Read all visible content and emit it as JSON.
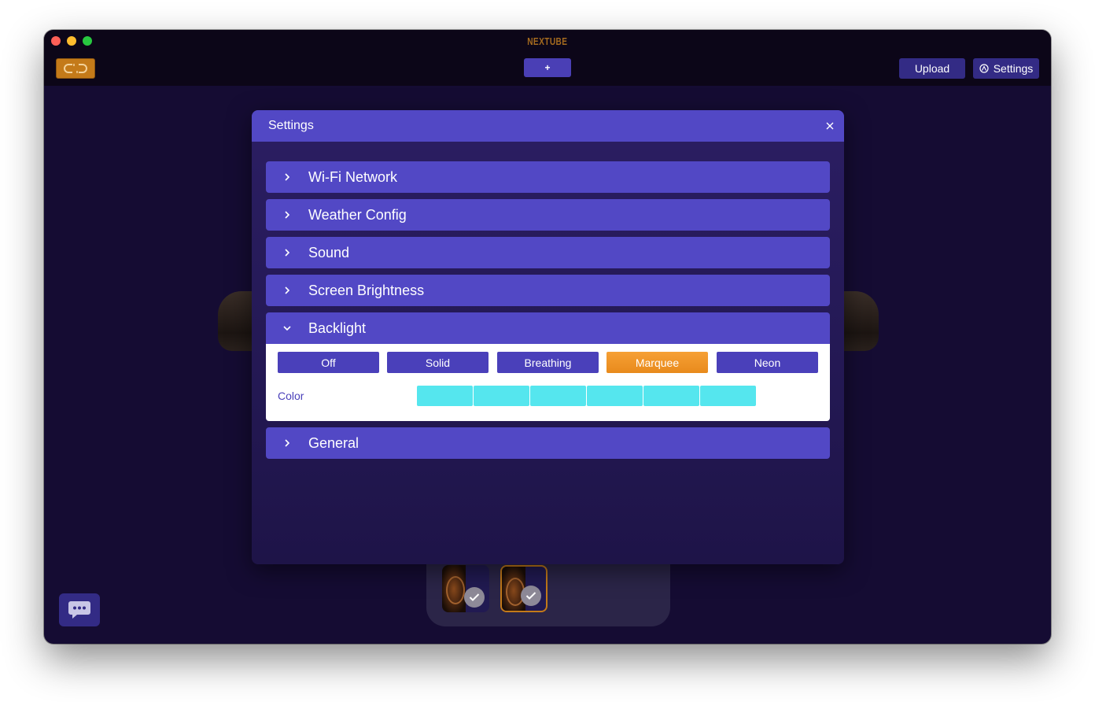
{
  "window": {
    "app_title": "NEXTUBE"
  },
  "toolbar": {
    "link_icon": "link-icon",
    "add_label": "+",
    "upload_label": "Upload",
    "settings_label": "Settings",
    "settings_icon": "gear-icon"
  },
  "modal": {
    "title": "Settings",
    "close_icon": "close-icon",
    "sections": [
      {
        "label": "Wi-Fi Network",
        "expanded": false
      },
      {
        "label": "Weather Config",
        "expanded": false
      },
      {
        "label": "Sound",
        "expanded": false
      },
      {
        "label": "Screen Brightness",
        "expanded": false
      },
      {
        "label": "Backlight",
        "expanded": true
      },
      {
        "label": "General",
        "expanded": false
      }
    ],
    "backlight": {
      "modes": [
        "Off",
        "Solid",
        "Breathing",
        "Marquee",
        "Neon"
      ],
      "selected_mode": "Marquee",
      "color_label": "Color",
      "swatches": [
        "#55e6ee",
        "#55e6ee",
        "#55e6ee",
        "#55e6ee",
        "#55e6ee",
        "#55e6ee"
      ]
    }
  },
  "thumbnails": {
    "items": [
      {
        "selected": false,
        "checked": true
      },
      {
        "selected": true,
        "checked": true
      }
    ]
  },
  "colors": {
    "accent": "#5248c5",
    "orange": "#e88a1c",
    "background": "#150c33"
  }
}
